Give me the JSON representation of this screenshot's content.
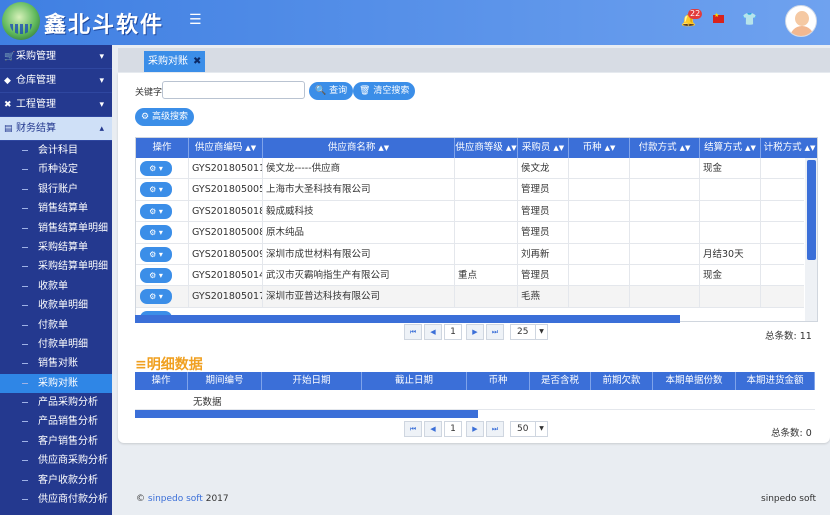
{
  "header": {
    "brand": "鑫北斗软件",
    "notification_count": "22",
    "icons": [
      "menu-icon",
      "bell-icon",
      "china-flag-icon",
      "shirt-icon",
      "user-avatar"
    ]
  },
  "sidebar": {
    "sections": [
      {
        "label": "采购管理",
        "icon": "cart-icon"
      },
      {
        "label": "仓库管理",
        "icon": "cube-icon"
      },
      {
        "label": "工程管理",
        "icon": "wrench-icon"
      },
      {
        "label": "财务结算",
        "icon": "file-icon"
      }
    ],
    "items": [
      "会计科目",
      "币种设定",
      "银行账户",
      "销售结算单",
      "销售结算单明细",
      "采购结算单",
      "采购结算单明细",
      "收款单",
      "收款单明细",
      "付款单",
      "付款单明细",
      "销售对账",
      "采购对账",
      "产品采购分析",
      "产品销售分析",
      "客户销售分析",
      "供应商采购分析",
      "客户收款分析",
      "供应商付款分析"
    ],
    "active_item": "采购对账"
  },
  "tabs": [
    {
      "label": "采购对账",
      "close": "✖"
    }
  ],
  "search": {
    "keyword_label": "关键字",
    "keyword_value": "",
    "query_button": "查询",
    "clear_button": "清空搜索",
    "advanced_button": "高级搜索"
  },
  "main_table": {
    "columns": [
      "操作",
      "供应商编码",
      "供应商名称",
      "供应商等级",
      "采购员",
      "币种",
      "付款方式",
      "结算方式",
      "计税方式"
    ],
    "rows": [
      {
        "code": "GYS201805011",
        "name": "侯文龙-----供应商",
        "level": "",
        "buyer": "侯文龙",
        "currency": "",
        "payment": "",
        "settlement": "现金",
        "tax": ""
      },
      {
        "code": "GYS201805005",
        "name": "上海市大圣科技有限公司",
        "level": "",
        "buyer": "管理员",
        "currency": "",
        "payment": "",
        "settlement": "",
        "tax": ""
      },
      {
        "code": "GYS201805018",
        "name": "毅成威科技",
        "level": "",
        "buyer": "管理员",
        "currency": "",
        "payment": "",
        "settlement": "",
        "tax": ""
      },
      {
        "code": "GYS201805008",
        "name": "原木纯品",
        "level": "",
        "buyer": "管理员",
        "currency": "",
        "payment": "",
        "settlement": "",
        "tax": ""
      },
      {
        "code": "GYS201805009",
        "name": "深圳市成世材料有限公司",
        "level": "",
        "buyer": "刘再新",
        "currency": "",
        "payment": "",
        "settlement": "月结30天",
        "tax": ""
      },
      {
        "code": "GYS201805014",
        "name": "武汉市灭霸响指生产有限公司",
        "level": "重点",
        "buyer": "管理员",
        "currency": "",
        "payment": "",
        "settlement": "现金",
        "tax": ""
      },
      {
        "code": "GYS201805017",
        "name": "深圳市亚普达科技有限公司",
        "level": "",
        "buyer": "毛燕",
        "currency": "",
        "payment": "",
        "settlement": "",
        "tax": ""
      }
    ],
    "op_button": "⚙ ▾",
    "pager": {
      "page": "1",
      "page_size": "25",
      "total_label": "总条数: 11"
    }
  },
  "detail": {
    "title": "明细数据",
    "columns": [
      "操作",
      "期间编号",
      "开始日期",
      "截止日期",
      "币种",
      "是否含税",
      "前期欠款",
      "本期单据份数",
      "本期进货金额"
    ],
    "empty_text": "无数据",
    "pager": {
      "page": "1",
      "page_size": "50",
      "total_label": "总条数: 0"
    }
  },
  "footer": {
    "copyright_prefix": "©",
    "company_link": "sinpedo soft",
    "year": "2017",
    "right_text": "sinpedo soft"
  }
}
